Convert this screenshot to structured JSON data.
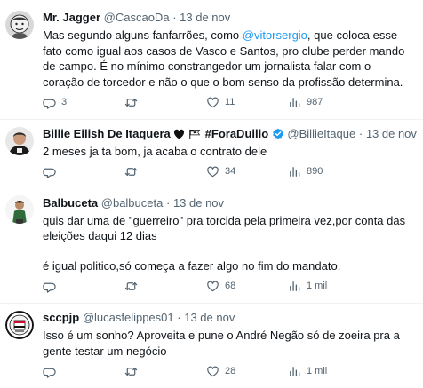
{
  "tweets": [
    {
      "name": "Mr. Jagger",
      "handle": "@CascaoDa",
      "dot": "·",
      "date": "13 de nov",
      "text_before": "Mas segundo alguns fanfarrões, como ",
      "mention": "@vitorsergio",
      "text_after": ", que coloca esse fato como igual aos casos de Vasco e Santos, pro clube perder mando de campo. É no mínimo constrangedor um jornalista falar com o coração de torcedor e não o que o bom senso da profissão determina.",
      "replies": "3",
      "retweets": "",
      "likes": "11",
      "views": "987"
    },
    {
      "name": "Billie Eilish De Itaquera",
      "name_suffix": "#ForaDuilio",
      "handle": "@BillieItaque",
      "dot": "·",
      "date": "13 de nov",
      "text": "2 meses ja ta bom, ja acaba o contrato dele",
      "replies": "",
      "retweets": "",
      "likes": "34",
      "views": "890"
    },
    {
      "name": "Balbuceta",
      "handle": "@balbuceta",
      "dot": "·",
      "date": "13 de nov",
      "line1": "quis dar uma de \"guerreiro\" pra torcida pela primeira vez,por conta das eleições daqui 12 dias",
      "line2": "é igual politico,só começa a fazer algo no fim do mandato.",
      "replies": "",
      "retweets": "",
      "likes": "68",
      "views": "1 mil"
    },
    {
      "name": "sccpjp",
      "handle": "@lucasfelippes01",
      "dot": "·",
      "date": "13 de nov",
      "text": "Isso é um sonho? Aproveita e pune o André Negão só de zoeira pra a gente testar um negócio",
      "replies": "",
      "retweets": "",
      "likes": "28",
      "views": "1 mil"
    }
  ],
  "icons": {
    "reply": "reply-icon",
    "retweet": "retweet-icon",
    "like": "heart-icon",
    "views": "views-icon",
    "verified": "verified-badge-icon",
    "heart_emoji": "black-heart-emoji",
    "flag_emoji": "flag-emoji"
  },
  "colors": {
    "text": "#0f1419",
    "muted": "#536471",
    "link": "#1d9bf0",
    "divider": "#eff3f4"
  }
}
